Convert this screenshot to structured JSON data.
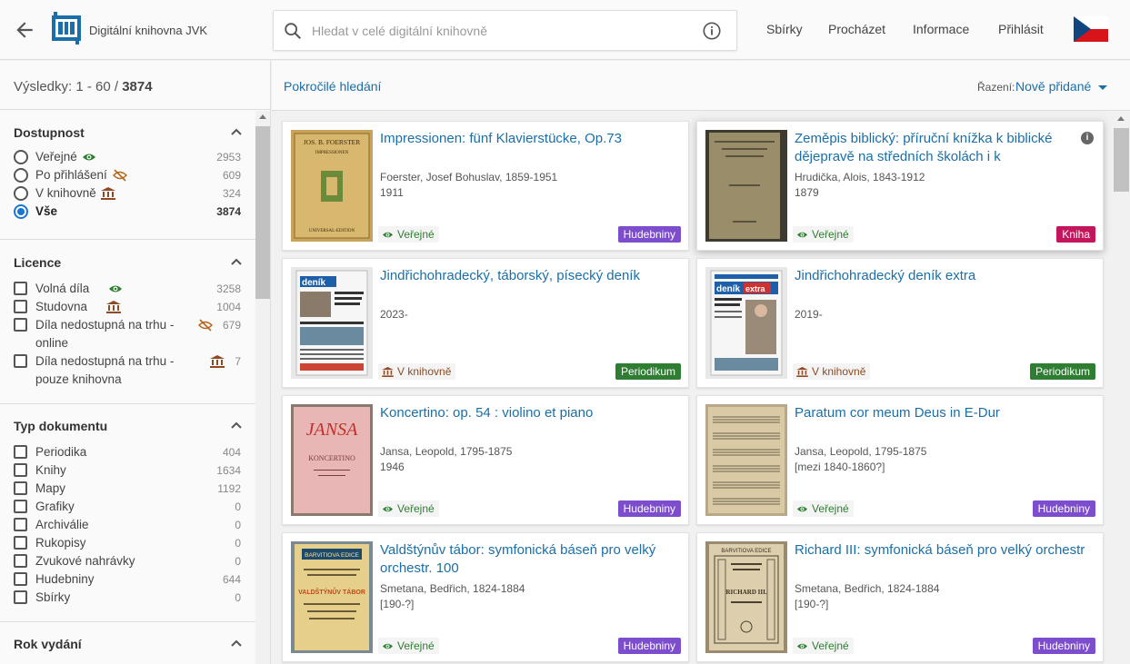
{
  "header": {
    "brand": "Digitální knihovna JVK",
    "search_placeholder": "Hledat v celé digitální knihovně",
    "nav": [
      "Sbírky",
      "Procházet",
      "Informace",
      "Přihlásit"
    ]
  },
  "sidebar": {
    "results_prefix": "Výsledky: 1 - 60 / ",
    "results_total": "3874",
    "facets": {
      "access": {
        "title": "Dostupnost",
        "items": [
          {
            "label": "Veřejné",
            "count": "2953",
            "icon": "eye-icon"
          },
          {
            "label": "Po přihlášení",
            "count": "609",
            "icon": "eye-off-icon"
          },
          {
            "label": "V knihovně",
            "count": "324",
            "icon": "library-icon"
          },
          {
            "label": "Vše",
            "count": "3874",
            "selected": true
          }
        ]
      },
      "license": {
        "title": "Licence",
        "items": [
          {
            "label": "Volná díla",
            "count": "3258",
            "icon": "eye-icon"
          },
          {
            "label": "Studovna",
            "count": "1004",
            "icon": "library-icon"
          },
          {
            "label": "Díla nedostupná na trhu - online",
            "count": "679",
            "icon": "eye-off-icon"
          },
          {
            "label": "Díla nedostupná na trhu - pouze knihovna",
            "count": "7",
            "icon": "library-icon"
          }
        ]
      },
      "doctype": {
        "title": "Typ dokumentu",
        "items": [
          {
            "label": "Periodika",
            "count": "404"
          },
          {
            "label": "Knihy",
            "count": "1634"
          },
          {
            "label": "Mapy",
            "count": "1192"
          },
          {
            "label": "Grafiky",
            "count": "0"
          },
          {
            "label": "Archiválie",
            "count": "0"
          },
          {
            "label": "Rukopisy",
            "count": "0"
          },
          {
            "label": "Zvukové nahrávky",
            "count": "0"
          },
          {
            "label": "Hudebniny",
            "count": "644"
          },
          {
            "label": "Sbírky",
            "count": "0"
          }
        ]
      },
      "year": {
        "title": "Rok vydání"
      }
    }
  },
  "main": {
    "advanced": "Pokročilé hledání",
    "sort_label": "Řazení:",
    "sort_value": "Nově přidané",
    "cards": [
      {
        "title": "Impressionen: fünf Klavierstücke, Op.73",
        "author": "Foerster, Josef Bohuslav, 1859-1951",
        "year": "1911",
        "access": "Veřejné",
        "type": "Hudebniny"
      },
      {
        "title": "Zeměpis biblický: příruční knížka k biblické dějepravě na středních školách i k soukromém...",
        "author": "Hrudička, Alois, 1843-1912",
        "year": "1879",
        "access": "Veřejné",
        "type": "Kniha"
      },
      {
        "title": "Jindřichohradecký, táborský, písecký deník",
        "author": "",
        "year": "2023-",
        "access": "V knihovně",
        "type": "Periodikum"
      },
      {
        "title": "Jindřichohradecký deník extra",
        "author": "",
        "year": "2019-",
        "access": "V knihovně",
        "type": "Periodikum"
      },
      {
        "title": "Koncertino: op. 54 : violino et piano",
        "author": "Jansa, Leopold, 1795-1875",
        "year": "1946",
        "access": "Veřejné",
        "type": "Hudebniny"
      },
      {
        "title": "Paratum cor meum Deus in E-Dur",
        "author": "Jansa, Leopold, 1795-1875",
        "year": "[mezi 1840-1860?]",
        "access": "Veřejné",
        "type": "Hudebniny"
      },
      {
        "title": "Valdštýnův tábor: symfonická báseň pro velký orchestr. 100",
        "author": "Smetana, Bedřich, 1824-1884",
        "year": "[190-?]",
        "access": "Veřejné",
        "type": "Hudebniny"
      },
      {
        "title": "Richard III: symfonická báseň pro velký orchestr",
        "author": "Smetana, Bedřich, 1824-1884",
        "year": "[190-?]",
        "access": "Veřejné",
        "type": "Hudebniny"
      }
    ],
    "thumb_text": {
      "c0_top": "JOS. B. FOERSTER",
      "c0_mid": "IMPRESSIONEN",
      "c0_bot": "UNIVERSAL-EDITION",
      "c2_logo": "deník",
      "c3_logo": "deník",
      "c3_extra": "extra",
      "c4_top": "JANSA",
      "c4_mid": "KONCERTINO",
      "c6_top": "BARVITIOVA EDICE",
      "c6_mid": "VALDŠTÝNŮV TÁBOR",
      "c7_top": "BARVITIOVA EDICE",
      "c7_mid": "RICHARD III."
    }
  }
}
